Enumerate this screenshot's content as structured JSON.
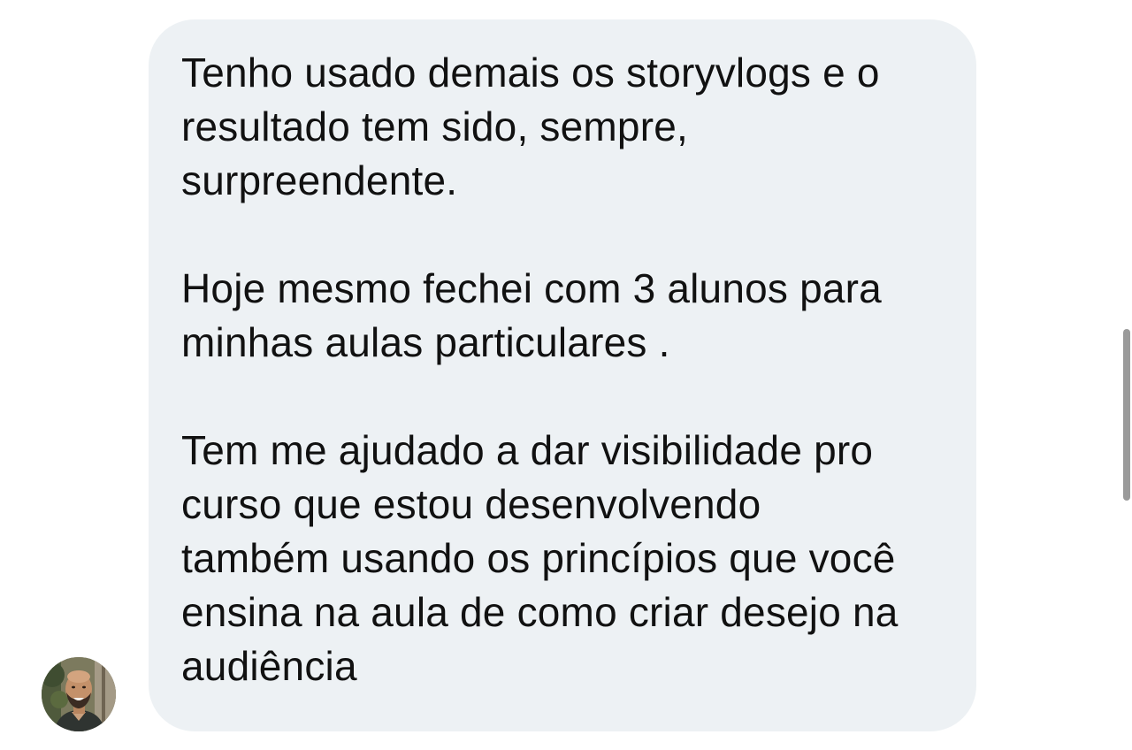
{
  "message": {
    "paragraphs": [
      "Tenho usado demais os storyvlogs e o\nresultado tem sido, sempre,\nsurpreendente.",
      "Hoje mesmo fechei com 3 alunos para\nminhas aulas particulares .",
      "Tem me ajudado a dar visibilidade pro\ncurso que estou desenvolvendo\ntambém usando os princípios que você\nensina na aula de como criar desejo na\naudiência"
    ]
  },
  "sender": {
    "avatar_icon": "profile-photo-icon"
  },
  "colors": {
    "bubble": "#edf1f4",
    "text": "#111111",
    "background": "#ffffff",
    "scrollbar": "#9a9a9a"
  }
}
